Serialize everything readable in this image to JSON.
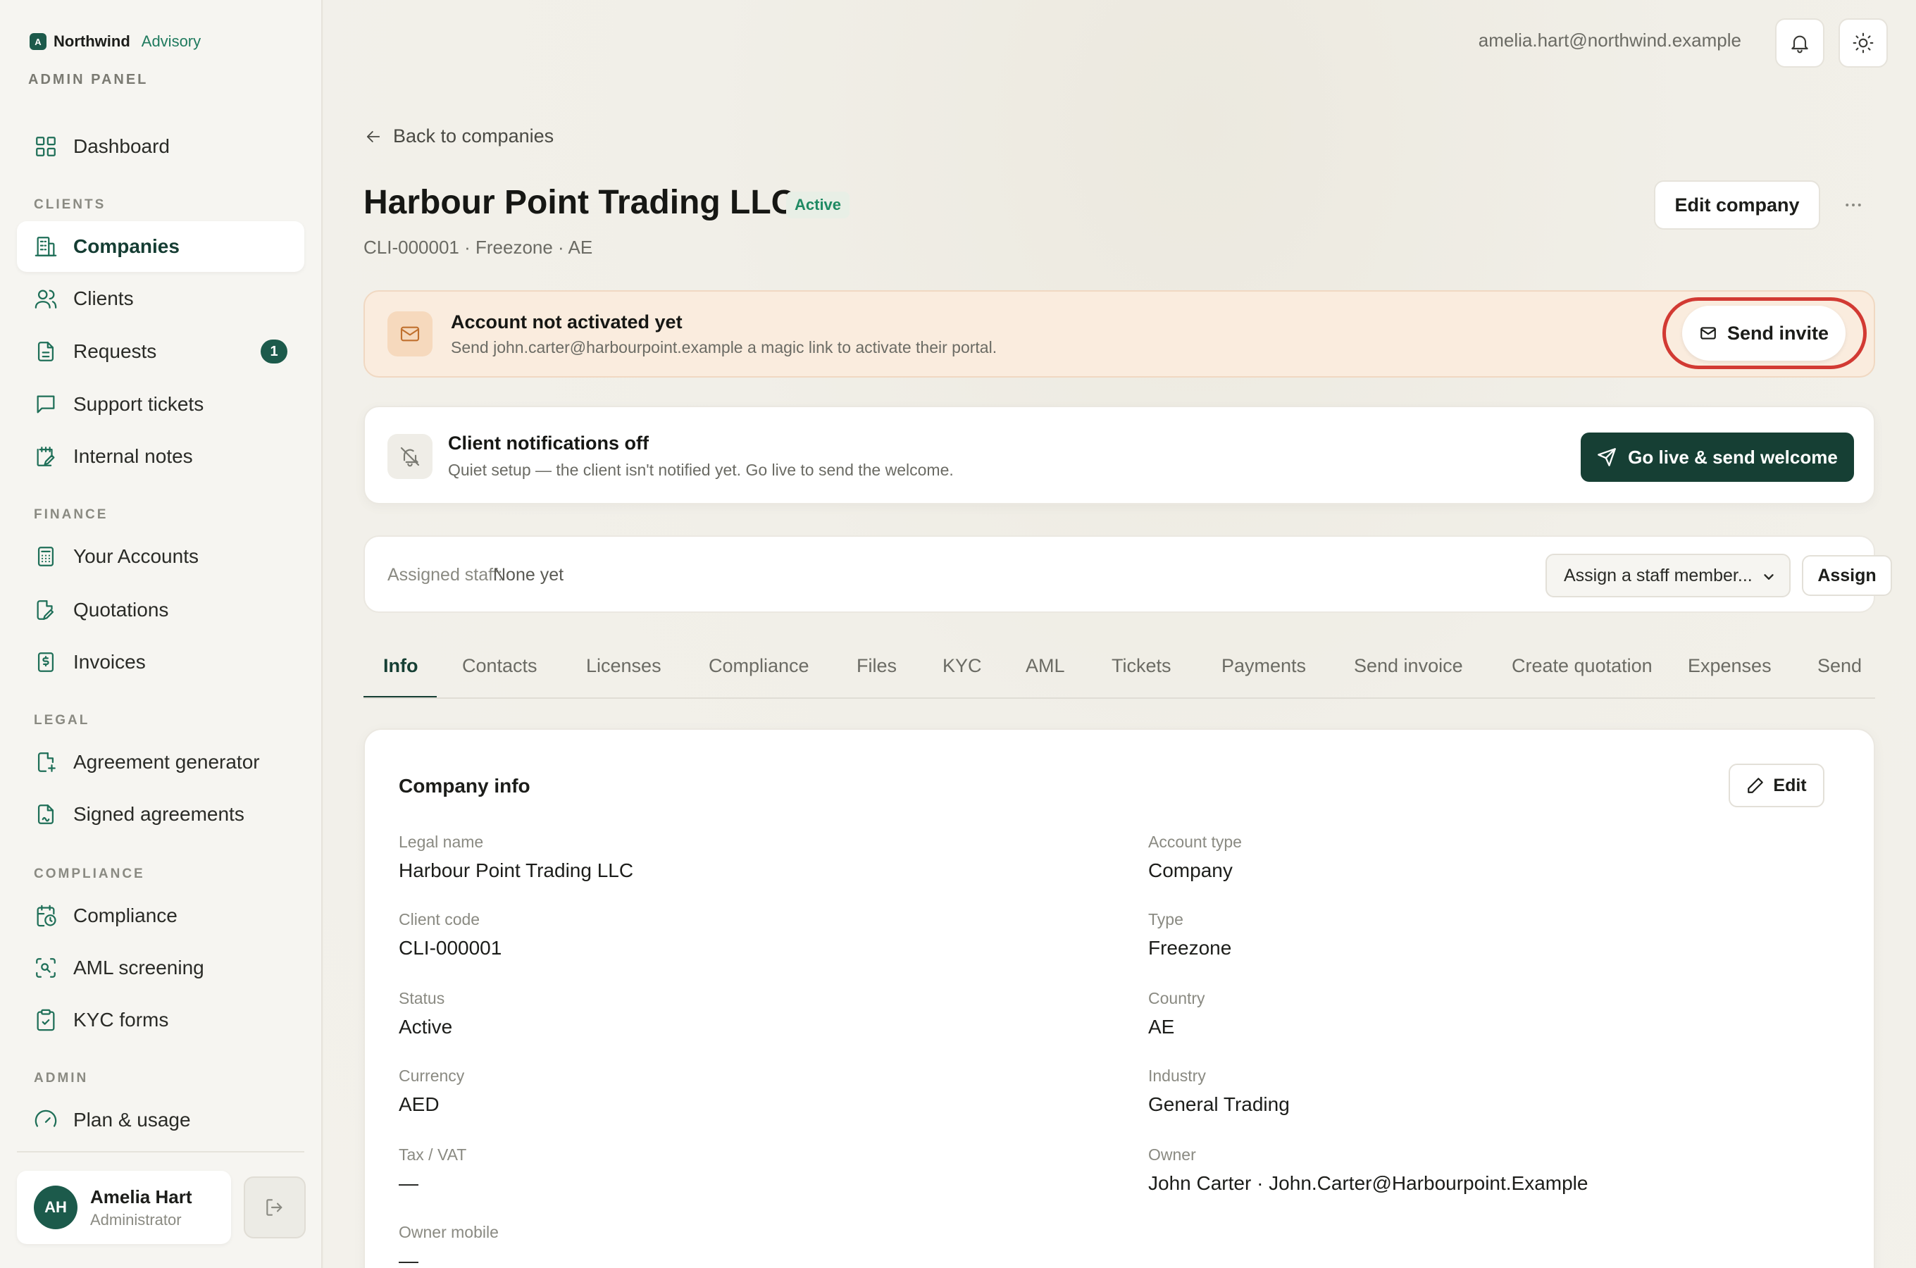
{
  "brand": {
    "name": "Northwind",
    "sub": "Advisory",
    "badge": "A",
    "panel_label": "ADMIN PANEL"
  },
  "sidebar": {
    "sections": {
      "clients": "CLIENTS",
      "finance": "FINANCE",
      "legal": "LEGAL",
      "compliance": "COMPLIANCE",
      "admin": "ADMIN"
    },
    "items": [
      {
        "label": "Dashboard",
        "icon": "grid-icon"
      },
      {
        "label": "Companies",
        "icon": "building-icon",
        "active": true
      },
      {
        "label": "Clients",
        "icon": "users-icon"
      },
      {
        "label": "Requests",
        "icon": "document-icon",
        "badge": "1"
      },
      {
        "label": "Support tickets",
        "icon": "message-icon"
      },
      {
        "label": "Internal notes",
        "icon": "note-icon"
      },
      {
        "label": "Your Accounts",
        "icon": "calculator-icon"
      },
      {
        "label": "Quotations",
        "icon": "file-edit-icon"
      },
      {
        "label": "Invoices",
        "icon": "receipt-icon"
      },
      {
        "label": "Agreement generator",
        "icon": "file-plus-icon"
      },
      {
        "label": "Signed agreements",
        "icon": "file-signed-icon"
      },
      {
        "label": "Compliance",
        "icon": "calendar-clock-icon"
      },
      {
        "label": "AML screening",
        "icon": "scan-icon"
      },
      {
        "label": "KYC forms",
        "icon": "clipboard-icon"
      },
      {
        "label": "Plan & usage",
        "icon": "gauge-icon"
      }
    ],
    "user": {
      "initials": "AH",
      "name": "Amelia Hart",
      "role": "Administrator"
    }
  },
  "topbar": {
    "email": "amelia.hart@northwind.example"
  },
  "page": {
    "back": "Back to companies",
    "title": "Harbour Point Trading LLC",
    "status": "Active",
    "subtitle": "CLI-000001 · Freezone · AE",
    "edit_company": "Edit company"
  },
  "banners": {
    "activation": {
      "title": "Account not activated yet",
      "desc": "Send john.carter@harbourpoint.example a magic link to activate their portal.",
      "button": "Send invite"
    },
    "notifications": {
      "title": "Client notifications off",
      "desc": "Quiet setup — the client isn't notified yet. Go live to send the welcome.",
      "button": "Go live & send welcome"
    }
  },
  "staff": {
    "label": "Assigned staff:",
    "value": "None yet",
    "select": "Assign a staff member...",
    "assign": "Assign"
  },
  "tabs": [
    "Info",
    "Contacts",
    "Licenses",
    "Compliance",
    "Files",
    "KYC",
    "AML",
    "Tickets",
    "Payments",
    "Send invoice",
    "Create quotation",
    "Expenses",
    "Send"
  ],
  "info": {
    "title": "Company info",
    "edit": "Edit",
    "left": [
      {
        "label": "Legal name",
        "value": "Harbour Point Trading LLC"
      },
      {
        "label": "Client code",
        "value": "CLI-000001"
      },
      {
        "label": "Status",
        "value": "Active"
      },
      {
        "label": "Currency",
        "value": "AED"
      },
      {
        "label": "Tax / VAT",
        "value": "—"
      },
      {
        "label": "Owner mobile",
        "value": "—"
      }
    ],
    "right": [
      {
        "label": "Account type",
        "value": "Company"
      },
      {
        "label": "Type",
        "value": "Freezone"
      },
      {
        "label": "Country",
        "value": "AE"
      },
      {
        "label": "Industry",
        "value": "General Trading"
      },
      {
        "label": "Owner",
        "value": "John Carter · John.Carter@Harbourpoint.Example"
      }
    ]
  },
  "colors": {
    "accent": "#163f34",
    "accent_light": "#1c5a4b",
    "alert_ring": "#d23a33",
    "warn_bg": "#faecde"
  }
}
